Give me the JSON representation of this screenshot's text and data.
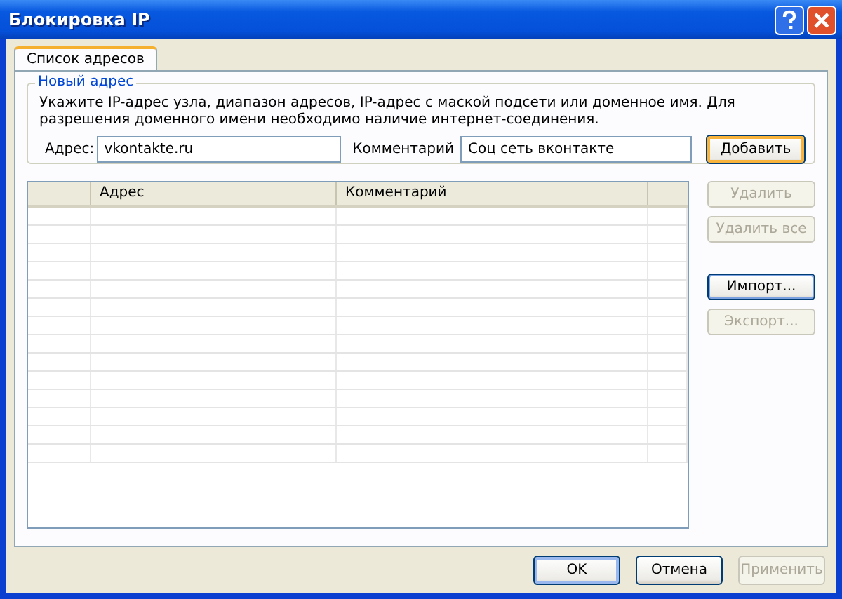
{
  "window": {
    "title": "Блокировка IP"
  },
  "tabs": [
    {
      "label": "Список адресов",
      "selected": true
    }
  ],
  "group": {
    "title": "Новый адрес",
    "hint": "Укажите IP-адрес узла, диапазон адресов, IP-адрес с маской подсети или доменное имя. Для разрешения доменного имени необходимо наличие интернет-соединения.",
    "address_label": "Адрес:",
    "address_value": "vkontakte.ru",
    "comment_label": "Комментарий",
    "comment_value": "Соц сеть вконтакте",
    "add_button": {
      "label": "Добавить",
      "disabled": false
    }
  },
  "table": {
    "columns": [
      "Адрес",
      "Комментарий"
    ]
  },
  "side_buttons": [
    {
      "label": "Удалить",
      "disabled": true
    },
    {
      "label": "Удалить все",
      "disabled": true
    },
    {
      "label": "Импорт...",
      "disabled": false
    },
    {
      "label": "Экспорт...",
      "disabled": true
    }
  ],
  "footer_buttons": [
    {
      "label": "OK",
      "disabled": false
    },
    {
      "label": "Отмена",
      "disabled": false
    },
    {
      "label": "Применить",
      "disabled": true
    }
  ]
}
